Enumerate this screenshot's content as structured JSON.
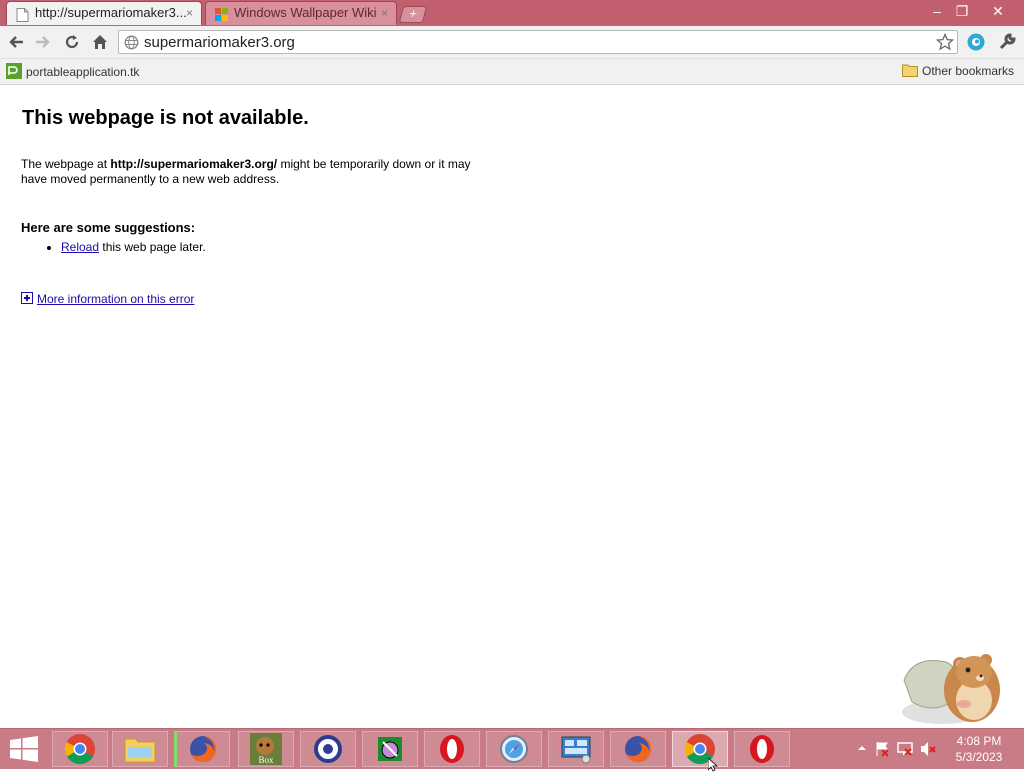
{
  "tabs": [
    {
      "title": "http://supermariomaker3...",
      "active": true
    },
    {
      "title": "Windows Wallpaper Wiki",
      "active": false
    }
  ],
  "tab_close_glyph": "×",
  "window_controls": {
    "minimize": "–",
    "restore": "❐",
    "close": "✕"
  },
  "omnibox": {
    "value": "supermariomaker3.org"
  },
  "bookmarks": {
    "left": "portableapplication.tk",
    "right": "Other bookmarks"
  },
  "error_page": {
    "heading": "This webpage is not available.",
    "msg_prefix": "The webpage at ",
    "msg_url": "http://supermariomaker3.org/",
    "msg_suffix": " might be temporarily down or it may have moved permanently to a new web address.",
    "suggestions_heading": "Here are some suggestions:",
    "reload_link": "Reload",
    "reload_suffix": " this web page later.",
    "more_info_link": "More information on this error"
  },
  "taskbar": {
    "box_label": "Box",
    "clock_time": "4:08 PM",
    "clock_date": "5/3/2023"
  },
  "colors": {
    "titlebar": "#c2606f",
    "taskbar": "#c97b86",
    "link": "#1a0dab"
  }
}
